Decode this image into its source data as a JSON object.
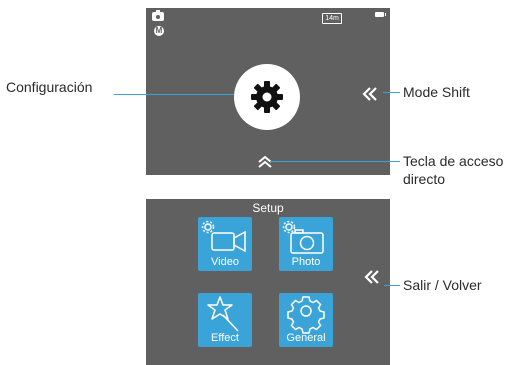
{
  "top_screen": {
    "status": {
      "mode_badge": "M",
      "remaining_time": "14m",
      "camera_icon": "camera-icon",
      "battery_icon": "battery-icon"
    },
    "center_icon": "gear-icon",
    "mode_shift_icon": "double-chevron-left-icon",
    "shortcut_icon": "double-chevron-up-icon"
  },
  "bottom_screen": {
    "title": "Setup",
    "tiles": [
      {
        "label": "Video",
        "icon": "video-camera-icon"
      },
      {
        "label": "Photo",
        "icon": "photo-camera-icon"
      },
      {
        "label": "Effect",
        "icon": "magic-wand-icon"
      },
      {
        "label": "General",
        "icon": "gear-icon"
      }
    ],
    "back_icon": "double-chevron-left-icon"
  },
  "callouts": {
    "configuracion": "Configuración",
    "mode_shift": "Mode Shift",
    "tecla_line1": "Tecla de acceso",
    "tecla_line2": "directo",
    "salir": "Salir / Volver"
  },
  "colors": {
    "screen_bg": "#606060",
    "accent": "#3aa4d9",
    "text": "#2a2a2a"
  }
}
